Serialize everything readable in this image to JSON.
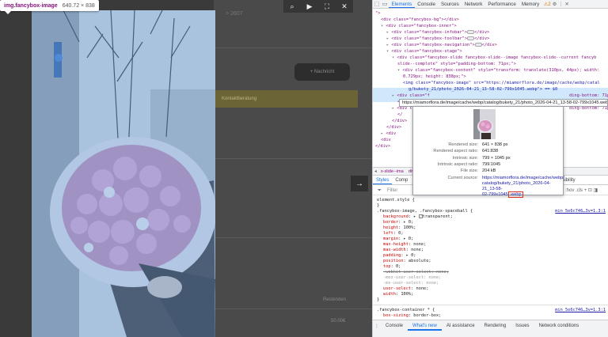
{
  "page": {
    "breadcrumb_tag": "> 2607",
    "notify_label": "+ Nachricht",
    "banner_label": "Kontaktberatung",
    "count_text": "Restenden",
    "bottom_text": "50.00€"
  },
  "tooltip": {
    "tag": "img.fancybox-image",
    "dims": "640.72 × 838"
  },
  "fancybox": {
    "toolbar": [
      {
        "name": "zoom-icon",
        "glyph": "⌕"
      },
      {
        "name": "play-icon",
        "glyph": "▶"
      },
      {
        "name": "fullscreen-icon",
        "glyph": "⛶"
      },
      {
        "name": "close-icon",
        "glyph": "✕"
      }
    ],
    "next_glyph": "→"
  },
  "devtools": {
    "tabs": [
      "Elements",
      "Console",
      "Sources",
      "Network",
      "Performance",
      "Memory"
    ],
    "active_tab": "Elements",
    "warning_count": "2",
    "issues_count": "2",
    "dom_lines": [
      {
        "indent": 0,
        "arrow": "",
        "text": "\">"
      },
      {
        "indent": 1,
        "arrow": "",
        "text": "<div class=\"fancybox-bg\"></div>"
      },
      {
        "indent": 1,
        "arrow": "▾",
        "text": "<div class=\"fancybox-inner\">"
      },
      {
        "indent": 2,
        "arrow": "▸",
        "text": "<div class=\"fancybox-infobar\">",
        "dots": true,
        "tail": "</div>"
      },
      {
        "indent": 2,
        "arrow": "▸",
        "text": "<div class=\"fancybox-toolbar\">",
        "dots": true,
        "tail": "</div>"
      },
      {
        "indent": 2,
        "arrow": "▸",
        "text": "<div class=\"fancybox-navigation\">",
        "dots": true,
        "tail": "</div>"
      },
      {
        "indent": 2,
        "arrow": "▾",
        "text": "<div class=\"fancybox-stage\">"
      },
      {
        "indent": 3,
        "arrow": "▾",
        "text": "<div class=\"fancybox-slide fancybox-slide--image fancybox-slide--current fancyb"
      },
      {
        "indent": 4,
        "arrow": "",
        "text": "slide--complete\" style=\"padding-bottom: 71px;\">"
      },
      {
        "indent": 4,
        "arrow": "▾",
        "text": "<div class=\"fancybox-content\" style=\"transform: translate(310px, 44px); width:"
      },
      {
        "indent": 5,
        "arrow": "",
        "text": "0.729px; height: 838px;\">"
      },
      {
        "indent": 5,
        "arrow": "",
        "text": "<img class=\"fancybox-image\" src=\"https://miamorflora.de/image/cache/webp/catal"
      },
      {
        "indent": 6,
        "arrow": "",
        "text": "g/bukety_21/photo_2026-04-21_13-58-02-799x1045.webp\"> == $0"
      },
      {
        "indent": 3,
        "arrow": "▸",
        "text": "<div class=\"f",
        "tail": "ding-bottom: 71px;\""
      },
      {
        "indent": 4,
        "arrow": "",
        "text": "</"
      },
      {
        "indent": 3,
        "arrow": "▸",
        "text": "<div class=\"f",
        "tail": "ding-bottom: 71px;\""
      },
      {
        "indent": 4,
        "arrow": "",
        "text": "</"
      },
      {
        "indent": 3,
        "arrow": "",
        "text": "</div>"
      },
      {
        "indent": 2,
        "arrow": "",
        "text": "</div>"
      },
      {
        "indent": 1,
        "arrow": "▸",
        "text": "<div"
      },
      {
        "indent": 1,
        "arrow": "",
        "text": "<div"
      },
      {
        "indent": 0,
        "arrow": "",
        "text": "</div>"
      }
    ],
    "url_tooltip": "https://miamorflora.de/image/cache/webp/catalog/bukety_21/photo_2026-04-21_13-58-02-799x1045.webp",
    "img_popup": {
      "rows": [
        {
          "k": "Rendered size:",
          "v": "641 × 838 px"
        },
        {
          "k": "Rendered aspect ratio:",
          "v": "641∶838"
        },
        {
          "k": "Intrinsic size:",
          "v": "799 × 1045 px"
        },
        {
          "k": "Intrinsic aspect ratio:",
          "v": "799∶1045"
        },
        {
          "k": "File size:",
          "v": "204 kB"
        }
      ],
      "source_label": "Current source:",
      "source_lines": [
        "https://miamorflora.de/image/cache/webp/",
        "catalog/bukety_21/photo_2026-04-21_13-58-",
        "02-799x1045"
      ],
      "source_ext": ".webp"
    },
    "breadcrumbs": [
      "x-slide--ima",
      "div.fancybox-content",
      "img.fancybox-ima"
    ],
    "sub_tabs": [
      "Styles",
      "Comp"
    ],
    "sub_tab_right": "Accessibility",
    "filter_placeholder": "Filter",
    "filter_right": ":hov .cls + ⊡ ◨",
    "styles": [
      {
        "t": "element.style {",
        "cls": "sel"
      },
      {
        "t": "}",
        "cls": "sel"
      },
      {
        "t": ".fancybox-image, .fancybox-spaceball {",
        "cls": "sel",
        "src": "min_5e6c746…3v=1.3:1"
      },
      {
        "t": "background: ▸ ",
        "prop": "background",
        "val": "transparent;",
        "swatch": true,
        "ind": true
      },
      {
        "t": "border: ▸ 0;",
        "prop": "border",
        "ind": true
      },
      {
        "t": "height: 100%;",
        "prop": "height",
        "ind": true
      },
      {
        "t": "left: 0;",
        "prop": "left",
        "ind": true
      },
      {
        "t": "margin: ▸ 0;",
        "prop": "margin",
        "ind": true
      },
      {
        "t": "max-height: none;",
        "prop": "max-height",
        "ind": true
      },
      {
        "t": "max-width: none;",
        "prop": "max-width",
        "ind": true
      },
      {
        "t": "padding: ▸ 0;",
        "prop": "padding",
        "ind": true
      },
      {
        "t": "position: absolute;",
        "prop": "position",
        "ind": true
      },
      {
        "t": "top: 0;",
        "prop": "top",
        "ind": true
      },
      {
        "t": "-webkit-user-select: none;",
        "ind": true,
        "strike": true
      },
      {
        "t": "-moz-user-select: none;",
        "ind": true,
        "faded": true
      },
      {
        "t": "-ms-user-select: none;",
        "ind": true,
        "faded": true
      },
      {
        "t": "user-select: none;",
        "prop": "user-select",
        "ind": true
      },
      {
        "t": "width: 100%;",
        "prop": "width",
        "ind": true
      },
      {
        "t": "}",
        "cls": "sel"
      },
      {
        "t": "",
        "sep": true
      },
      {
        "t": ".fancybox-container * {",
        "cls": "sel",
        "src": "min_5e6c746…3v=1.3:1"
      },
      {
        "t": "box-sizing: border-box;",
        "prop": "box-sizing",
        "ind": true
      }
    ],
    "drawer_tabs": [
      "Console",
      "What's new",
      "AI assistance",
      "Rendering",
      "Issues",
      "Network conditions"
    ],
    "drawer_active": "What's new"
  }
}
